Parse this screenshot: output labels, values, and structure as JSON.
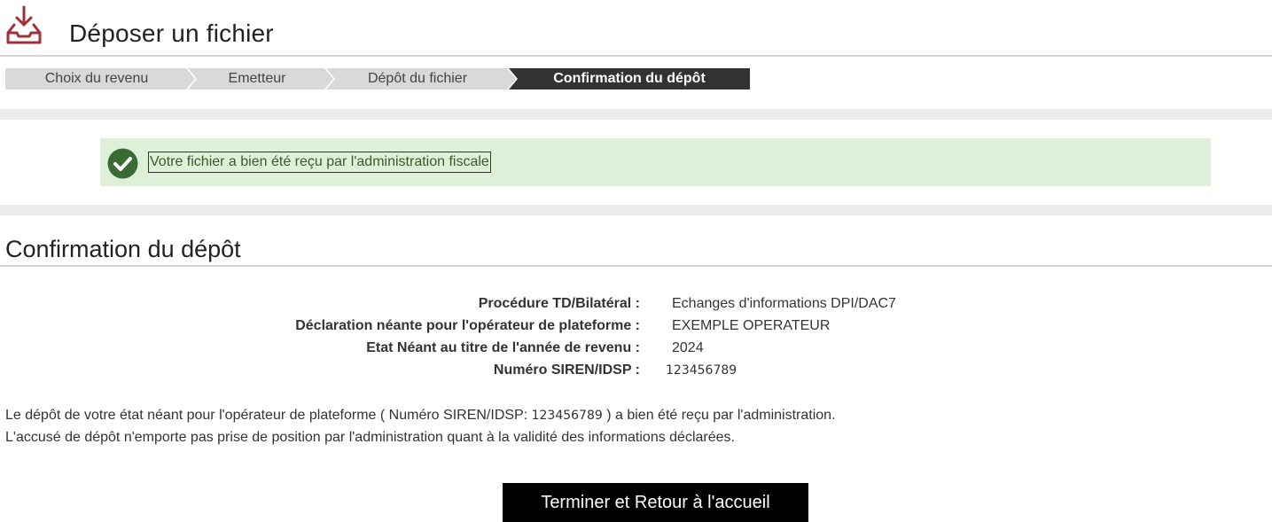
{
  "header": {
    "title": "Déposer un fichier",
    "icon": "inbox-download-icon",
    "icon_color": "#a0303a"
  },
  "steps": [
    {
      "label": "Choix du revenu",
      "active": false
    },
    {
      "label": "Emetteur",
      "active": false
    },
    {
      "label": "Dépôt du fichier",
      "active": false
    },
    {
      "label": "Confirmation du dépôt",
      "active": true
    }
  ],
  "alert": {
    "icon": "check-circle-icon",
    "text": "Votre fichier a bien été reçu par l'administration fiscale",
    "bg_color": "#dff0d8"
  },
  "section": {
    "title": "Confirmation du dépôt"
  },
  "details": [
    {
      "label": "Procédure TD/Bilatéral :",
      "value": "Echanges d'informations DPI/DAC7"
    },
    {
      "label": "Déclaration néante pour l'opérateur de plateforme :",
      "value": "EXEMPLE OPERATEUR"
    },
    {
      "label": "Etat Néant au titre de l'année de revenu :",
      "value": "2024"
    },
    {
      "label": "Numéro SIREN/IDSP :",
      "value": "123456789"
    }
  ],
  "message": {
    "line1_before": "Le dépôt de votre état néant pour l'opérateur de plateforme ( Numéro SIREN/IDSP: ",
    "line1_number": "123456789",
    "line1_after": " ) a bien été reçu par l'administration.",
    "line2": "L'accusé de dépôt n'emporte pas prise de position par l'administration quant à la validité des informations déclarées."
  },
  "actions": {
    "finish_label": "Terminer et Retour à l'accueil"
  }
}
